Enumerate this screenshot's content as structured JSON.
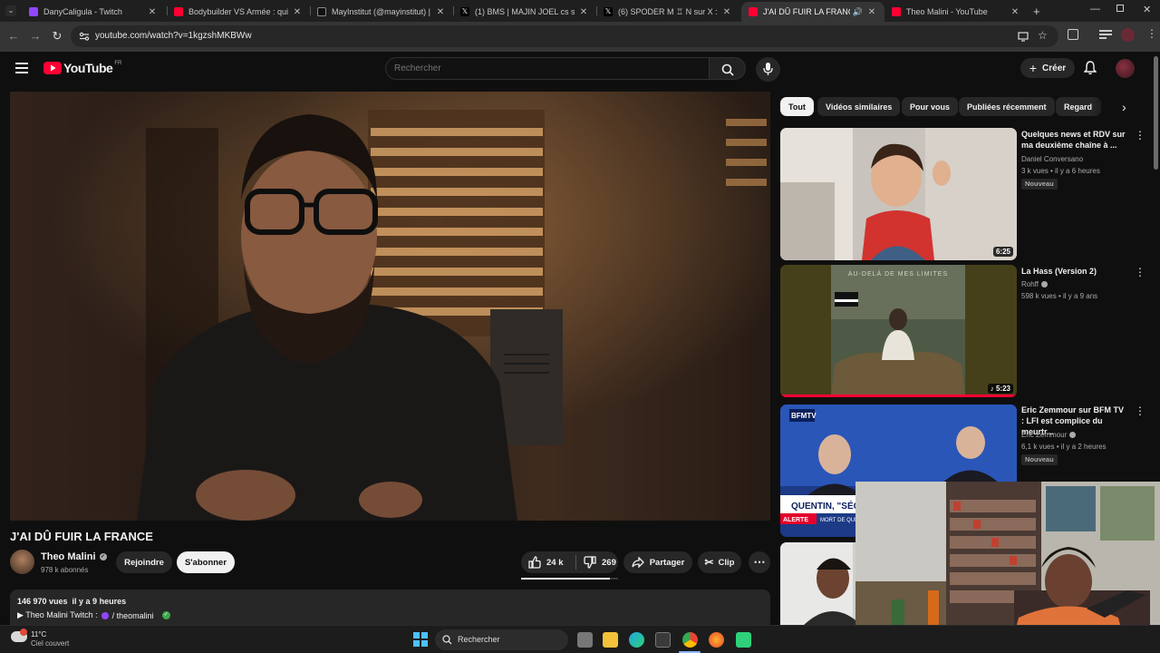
{
  "browser": {
    "tabs": [
      {
        "title": "DanyCaligula - Twitch",
        "active": false,
        "favicon_color": "#9146ff"
      },
      {
        "title": "Bodybuilder VS Armée : qui ser",
        "active": false,
        "favicon_color": "#ff0033"
      },
      {
        "title": "MayInstitut (@mayinstitut) | Tik",
        "active": false,
        "favicon_color": "#111111"
      },
      {
        "title": "(1) BMS | MAJIN JOEL cs sur X",
        "active": false,
        "favicon_color": "#000000"
      },
      {
        "title": "(6) SPODER M ♖ N sur X : \"Ah",
        "active": false,
        "favicon_color": "#000000"
      },
      {
        "title": "J'AI DÛ FUIR LA FRANCE - Y",
        "active": true,
        "favicon_color": "#ff0033"
      },
      {
        "title": "Theo Malini - YouTube",
        "active": false,
        "favicon_color": "#ff0033"
      }
    ],
    "url": "youtube.com/watch?v=1kgzshMKBWw"
  },
  "header": {
    "logo_text": "YouTube",
    "region": "FR",
    "search_placeholder": "Rechercher",
    "create_label": "Créer"
  },
  "video": {
    "title": "J'AI DÛ FUIR LA FRANCE",
    "channel": "Theo Malini",
    "subscribers": "978 k abonnés",
    "join_label": "Rejoindre",
    "subscribe_label": "S'abonner",
    "likes": "24 k",
    "dislikes": "269",
    "share_label": "Partager",
    "clip_label": "Clip",
    "views_date": "146 970 vues  il y a 9 heures",
    "desc_line": "▶ Theo Malini Twitch :",
    "desc_link": "/ theomalini"
  },
  "chips": [
    "Tout",
    "Vidéos similaires",
    "Pour vous",
    "Publiées récemment",
    "Regard"
  ],
  "recommendations": [
    {
      "title": "Quelques news et RDV sur ma deuxième chaîne à ...",
      "channel": "Daniel Conversano",
      "meta": "3 k vues • il y a 6 heures",
      "badge": "Nouveau",
      "duration": "6:25"
    },
    {
      "title": "La Hass (Version 2)",
      "channel": "Rohff",
      "meta": "598 k vues • il y a 9 ans",
      "badge": "",
      "duration": "5:23"
    },
    {
      "title": "Eric Zemmour sur BFM TV : LFI est complice du meurtr...",
      "channel": "Éric Zemmour",
      "meta": "6,1 k vues • il y a 2 heures",
      "badge": "Nouveau",
      "duration": ""
    }
  ],
  "thumb_text": {
    "album": "AU-DELÀ DE MES LIMITES",
    "bfm": "BFMTV",
    "headline": "QUENTIN, \"SÉQUENC",
    "alerte": "ALERTE",
    "mort": "MORT DE QUENTI"
  },
  "taskbar": {
    "temperature": "11°C",
    "weather": "Ciel couvert",
    "search_label": "Rechercher"
  }
}
